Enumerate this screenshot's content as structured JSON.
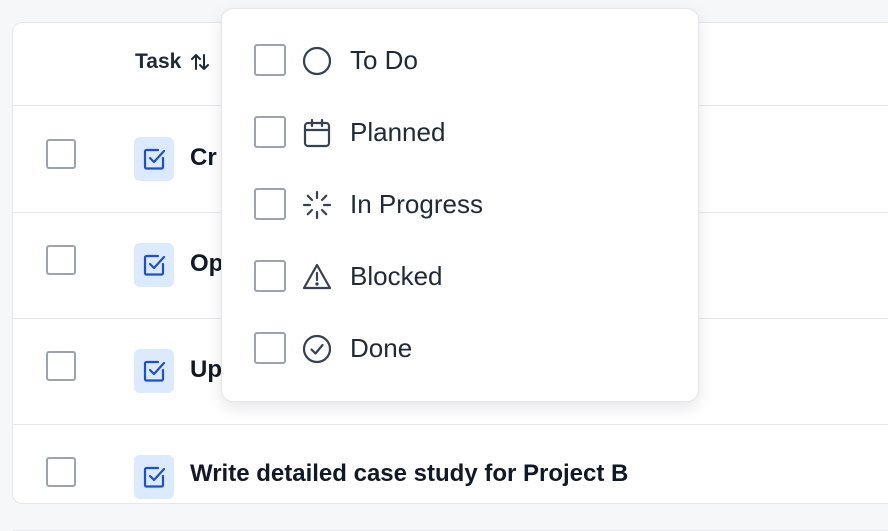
{
  "table": {
    "column_task": "Task",
    "rows": [
      {
        "title": "Cr"
      },
      {
        "title": "Op"
      },
      {
        "title": "Up"
      },
      {
        "title": "Write detailed case study for Project B"
      }
    ]
  },
  "status_menu": {
    "options": [
      {
        "label": "To Do",
        "icon": "circle-icon",
        "checked": false
      },
      {
        "label": "Planned",
        "icon": "calendar-icon",
        "checked": false
      },
      {
        "label": "In Progress",
        "icon": "loader-icon",
        "checked": false
      },
      {
        "label": "Blocked",
        "icon": "warning-icon",
        "checked": false
      },
      {
        "label": "Done",
        "icon": "check-circle-icon",
        "checked": false
      }
    ]
  },
  "colors": {
    "task_icon_bg": "#dbeafe",
    "task_icon_fg": "#1d4ed8",
    "border": "#e5e7eb",
    "text": "#1f2937"
  }
}
